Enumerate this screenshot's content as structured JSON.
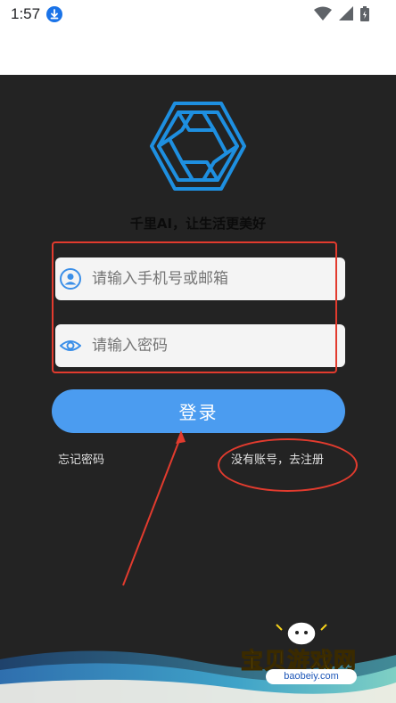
{
  "status_bar": {
    "time": "1:57",
    "icons": [
      "download-icon",
      "wifi-icon",
      "signal-icon",
      "battery-icon"
    ]
  },
  "login": {
    "slogan": "千里AI，让生活更美好",
    "phone_placeholder": "请输入手机号或邮箱",
    "password_placeholder": "请输入密码",
    "login_button": "登录",
    "forgot_password": "忘记密码",
    "register_link": "没有账号，去注册"
  },
  "watermark": {
    "brand_text": "宝贝游戏网",
    "url": "baobeiy.com"
  },
  "colors": {
    "accent": "#4b9cf0",
    "background": "#232323",
    "annotation": "#e23b2e",
    "logo": "#1e8fe0"
  }
}
